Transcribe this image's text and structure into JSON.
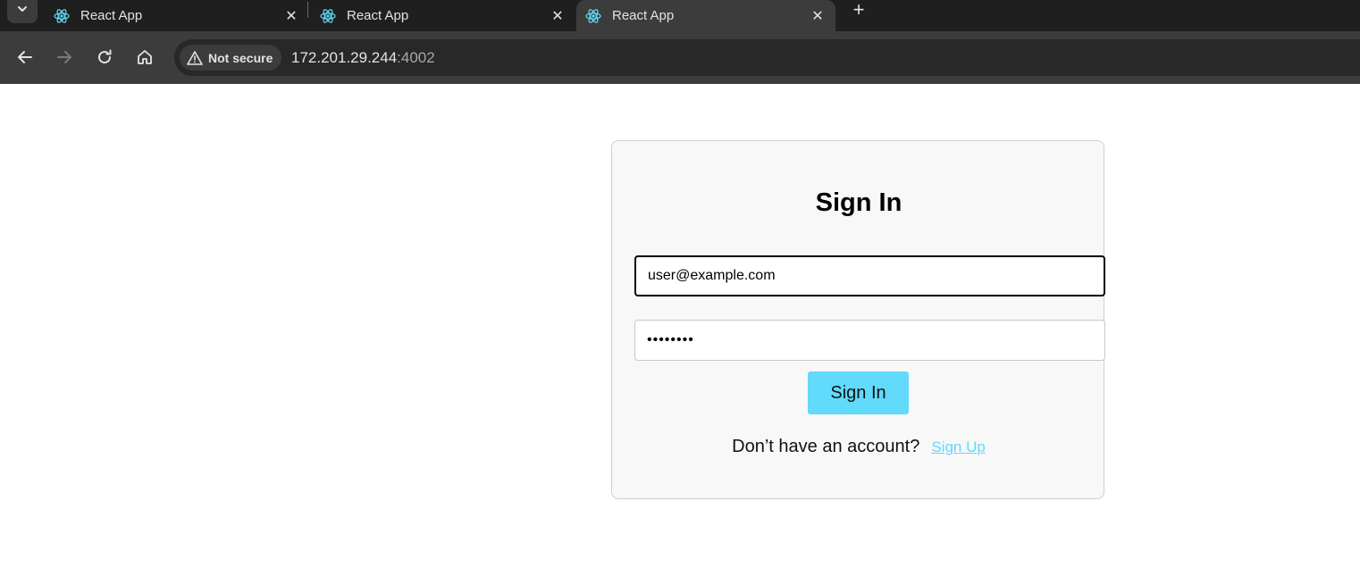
{
  "browser": {
    "tabs": [
      {
        "title": "React App"
      },
      {
        "title": "React App"
      },
      {
        "title": "React App"
      }
    ],
    "security_label": "Not secure",
    "url_host": "172.201.29.244",
    "url_port": ":4002"
  },
  "colors": {
    "accent": "#61dafb",
    "tab_strip_bg": "#1f1f1f",
    "toolbar_bg": "#3c3c3c"
  },
  "signin": {
    "title": "Sign In",
    "email_value": "user@example.com",
    "password_value": "••••••••",
    "button_label": "Sign In",
    "prompt_text": "Don’t have an account?",
    "signup_link": "Sign Up"
  }
}
